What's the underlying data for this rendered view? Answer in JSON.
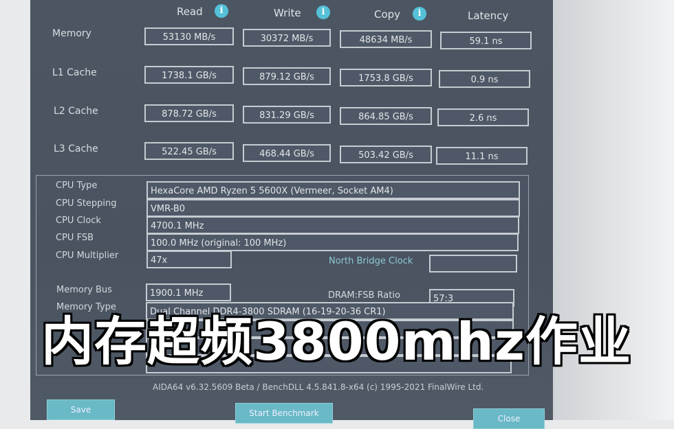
{
  "headers": {
    "read": "Read",
    "write": "Write",
    "copy": "Copy",
    "latency": "Latency"
  },
  "rows": [
    {
      "label": "Memory",
      "read": "53130 MB/s",
      "write": "30372 MB/s",
      "copy": "48634 MB/s",
      "latency": "59.1 ns"
    },
    {
      "label": "L1 Cache",
      "read": "1738.1 GB/s",
      "write": "879.12 GB/s",
      "copy": "1753.8 GB/s",
      "latency": "0.9 ns"
    },
    {
      "label": "L2 Cache",
      "read": "878.72 GB/s",
      "write": "831.29 GB/s",
      "copy": "864.85 GB/s",
      "latency": "2.6 ns"
    },
    {
      "label": "L3 Cache",
      "read": "522.45 GB/s",
      "write": "468.44 GB/s",
      "copy": "503.42 GB/s",
      "latency": "11.1 ns"
    }
  ],
  "cpu": {
    "type_label": "CPU Type",
    "type": "HexaCore AMD Ryzen 5 5600X  (Vermeer, Socket AM4)",
    "stepping_label": "CPU Stepping",
    "stepping": "VMR-B0",
    "clock_label": "CPU Clock",
    "clock": "4700.1 MHz",
    "fsb_label": "CPU FSB",
    "fsb": "100.0 MHz  (original: 100 MHz)",
    "mult_label": "CPU Multiplier",
    "mult": "47x",
    "nb_label": "North Bridge Clock",
    "nb": ""
  },
  "memory": {
    "bus_label": "Memory Bus",
    "bus": "1900.1 MHz",
    "ratio_label": "DRAM:FSB Ratio",
    "ratio": "57:3",
    "type_label": "Memory Type",
    "type": "Dual Channel DDR4-3800 SDRAM  (16-19-20-36 CR1)"
  },
  "footer": "AIDA64 v6.32.5609 Beta / BenchDLL 4.5.841.8-x64  (c) 1995-2021 FinalWire Ltd.",
  "buttons": {
    "save": "Save",
    "start": "Start Benchmark",
    "close": "Close"
  },
  "caption": "内存超频3800mhz作业",
  "icons": {
    "info": "info-icon"
  },
  "colors": {
    "accent": "#55c1d8",
    "window": "#4c5663"
  }
}
